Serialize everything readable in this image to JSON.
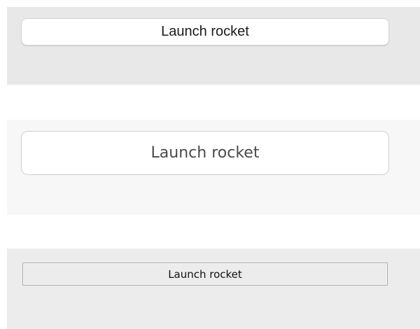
{
  "buttons": [
    {
      "label": "Launch rocket"
    },
    {
      "label": "Launch rocket"
    },
    {
      "label": "Launch rocket"
    }
  ],
  "colors": {
    "panel_1_background": "#e8e8e8",
    "panel_2_background": "#f7f7f7",
    "panel_3_background": "#ececec",
    "button_1_background": "#ffffff",
    "button_2_background": "#ffffff",
    "button_3_background": "#ececec"
  }
}
